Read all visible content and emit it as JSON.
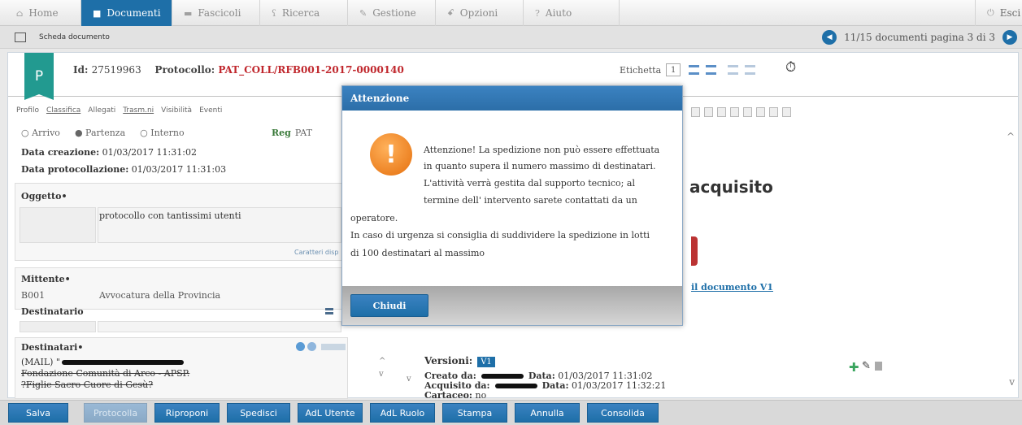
{
  "nav": {
    "tabs": [
      {
        "label": "Home",
        "icon": "home-icon"
      },
      {
        "label": "Documenti",
        "icon": "document-icon"
      },
      {
        "label": "Fascicoli",
        "icon": "folder-icon"
      },
      {
        "label": "Ricerca",
        "icon": "search-icon"
      },
      {
        "label": "Gestione",
        "icon": "wrench-icon"
      },
      {
        "label": "Opzioni",
        "icon": "people-icon"
      },
      {
        "label": "Aiuto",
        "icon": "help-icon"
      }
    ],
    "exit_label": "Esci",
    "active_color": "#1e6fa8"
  },
  "subbar": {
    "breadcrumb": "Scheda documento",
    "pager_text": "11/15 documenti pagina 3 di 3"
  },
  "doc": {
    "badge": "P",
    "id_label": "Id:",
    "id_value": "27519963",
    "protocollo_label": "Protocollo:",
    "protocollo_value": "PAT_COLL/RFB001-2017-0000140",
    "protocollo_color": "#c0272d",
    "etichetta_label": "Etichetta",
    "etichetta_value": "1"
  },
  "tabs": [
    "Profilo",
    "Classifica",
    "Allegati",
    "Trasm.ni",
    "Visibilità",
    "Eventi"
  ],
  "radios": [
    "Arrivo",
    "Partenza",
    "Interno"
  ],
  "reg": {
    "label": "Reg",
    "value": "PAT"
  },
  "meta": {
    "creazione_label": "Data creazione:",
    "creazione_value": "01/03/2017 11:31:02",
    "protocollazione_label": "Data protocollazione:",
    "protocollazione_value": "01/03/2017 11:31:03"
  },
  "oggetto": {
    "label": "Oggetto",
    "value": "protocollo con tantissimi utenti",
    "counter": "Caratteri disp"
  },
  "mittente": {
    "label": "Mittente",
    "code": "B001",
    "name": "Avvocatura della Provincia"
  },
  "destinatario_label": "Destinatario",
  "destinatari": {
    "label": "Destinatari",
    "line1": "(MAIL) \"",
    "line2": "Fondazione Comunità di Arco - APSP.",
    "line3": "?Figlie Sacro Cuore di Gesù?"
  },
  "versioni": {
    "label": "Versioni:",
    "current": "V1",
    "creato_label": "Creato da:",
    "creato_date_label": "Data:",
    "creato_date": "01/03/2017 11:31:02",
    "acquisito_label": "Acquisito da:",
    "acquisito_date_label": "Data:",
    "acquisito_date": "01/03/2017 11:32:21",
    "cartaceo_label": "Cartaceo:",
    "cartaceo_value": "no"
  },
  "right": {
    "acquisito_text": "acquisito",
    "doc_link": "il documento V1"
  },
  "modal": {
    "title": "Attenzione",
    "lines": [
      "Attenzione! La spedizione non può essere effettuata",
      "in quanto supera il numero massimo di destinatari.",
      "L'attività verrà gestita dal supporto tecnico; al",
      "termine dell' intervento sarete contattati da un",
      "operatore.",
      "In caso di urgenza si consiglia di suddividere la spedizione in lotti",
      "di 100 destinatari al massimo"
    ],
    "button": "Chiudi"
  },
  "bottom_buttons": [
    {
      "label": "Salva",
      "enabled": true
    },
    {
      "label": "Protocolla",
      "enabled": false
    },
    {
      "label": "Riproponi",
      "enabled": true
    },
    {
      "label": "Spedisci",
      "enabled": true
    },
    {
      "label": "AdL Utente",
      "enabled": true
    },
    {
      "label": "AdL Ruolo",
      "enabled": true
    },
    {
      "label": "Stampa",
      "enabled": true
    },
    {
      "label": "Annulla",
      "enabled": true
    },
    {
      "label": "Consolida",
      "enabled": true
    }
  ]
}
